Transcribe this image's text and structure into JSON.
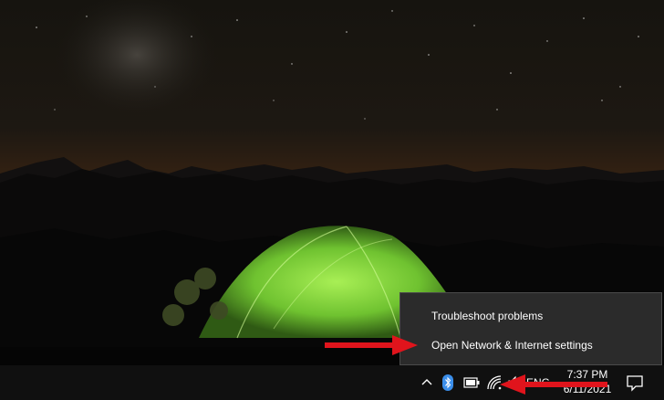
{
  "context_menu": {
    "items": [
      {
        "label": "Troubleshoot problems"
      },
      {
        "label": "Open Network & Internet settings"
      }
    ]
  },
  "taskbar": {
    "language": "ENG",
    "time": "7:37 PM",
    "date": "6/11/2021"
  },
  "tray_icons": [
    "chevron-up-icon",
    "bluetooth-icon",
    "battery-icon",
    "wifi-icon",
    "volume-icon",
    "notification-icon"
  ],
  "colors": {
    "annotation_arrow": "#e0141c",
    "menu_background": "#2b2b2b",
    "taskbar_background": "#101010",
    "bluetooth": "#3b8eea",
    "tent": "#7dd33a"
  }
}
